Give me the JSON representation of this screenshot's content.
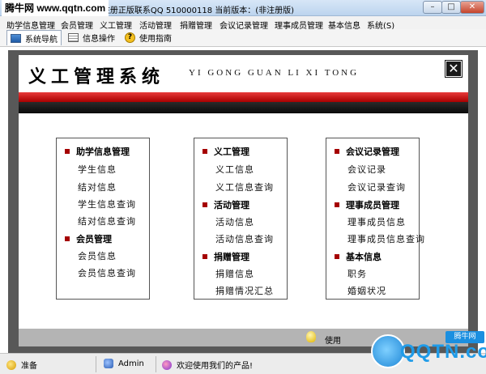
{
  "window": {
    "watermark": "腾牛网 www.qqtn.com",
    "title": "(未注册正版联系QQ 510000118   当前版本：(非注册版)"
  },
  "menu": [
    {
      "label": "助学信息管理"
    },
    {
      "label": "会员管理"
    },
    {
      "label": "义工管理"
    },
    {
      "label": "活动管理"
    },
    {
      "label": "捐赠管理"
    },
    {
      "label": "会议记录管理"
    },
    {
      "label": "理事成员管理"
    },
    {
      "label": "基本信息"
    },
    {
      "label": "系统(S)"
    }
  ],
  "toolbar": {
    "nav_label": "系统导航",
    "info_label": "信息操作",
    "guide_label": "使用指南"
  },
  "header": {
    "title": "义工管理系统",
    "pinyin": "YI GONG GUAN LI XI TONG",
    "close_glyph": "✕"
  },
  "panels": {
    "left": {
      "sec1": {
        "title": "助学信息管理",
        "items": [
          "学生信息",
          "结对信息",
          "学生信息查询",
          "结对信息查询"
        ]
      },
      "sec2": {
        "title": "会员管理",
        "items": [
          "会员信息",
          "会员信息查询"
        ]
      }
    },
    "mid": {
      "sec1": {
        "title": "义工管理",
        "items": [
          "义工信息",
          "义工信息查询"
        ]
      },
      "sec2": {
        "title": "活动管理",
        "items": [
          "活动信息",
          "活动信息查询"
        ]
      },
      "sec3": {
        "title": "捐赠管理",
        "items": [
          "捐赠信息",
          "捐赠情况汇总"
        ]
      }
    },
    "right": {
      "sec1": {
        "title": "会议记录管理",
        "items": [
          "会议记录",
          "会议记录查询"
        ]
      },
      "sec2": {
        "title": "理事成员管理",
        "items": [
          "理事成员信息",
          "理事成员信息查询"
        ]
      },
      "sec3": {
        "title": "基本信息",
        "items": [
          "职务",
          "婚姻状况"
        ]
      }
    }
  },
  "bottom": {
    "prompt": "使用"
  },
  "status": {
    "ready": "准备",
    "user": "Admin",
    "welcome": "欢迎使用我们的产品!"
  },
  "logo": {
    "text": "QQTN.com",
    "badge": "腾牛网"
  },
  "colors": {
    "accent_red": "#a90000",
    "frame_gray": "#585858"
  }
}
